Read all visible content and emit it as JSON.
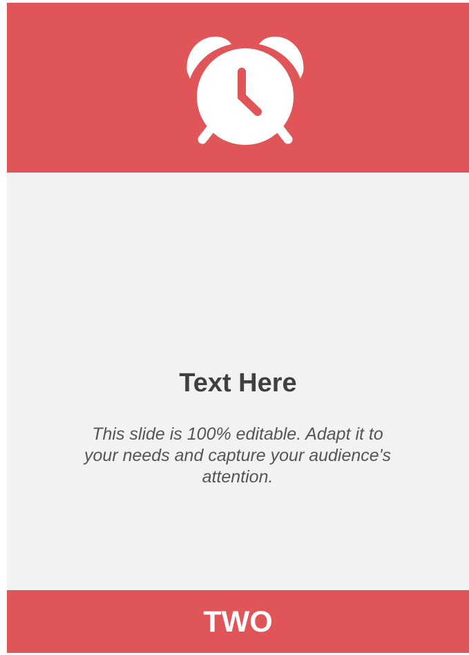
{
  "card": {
    "title": "Text Here",
    "description": "This slide is 100% editable. Adapt it to your needs and capture your audience's attention.",
    "footer_label": "TWO"
  },
  "icons": {
    "header_icon": "alarm-clock-icon"
  },
  "colors": {
    "accent": "#e05558",
    "panel_background": "#f2f2f2",
    "title_text": "#404040",
    "body_text": "#555555",
    "on_accent_text": "#ffffff"
  }
}
